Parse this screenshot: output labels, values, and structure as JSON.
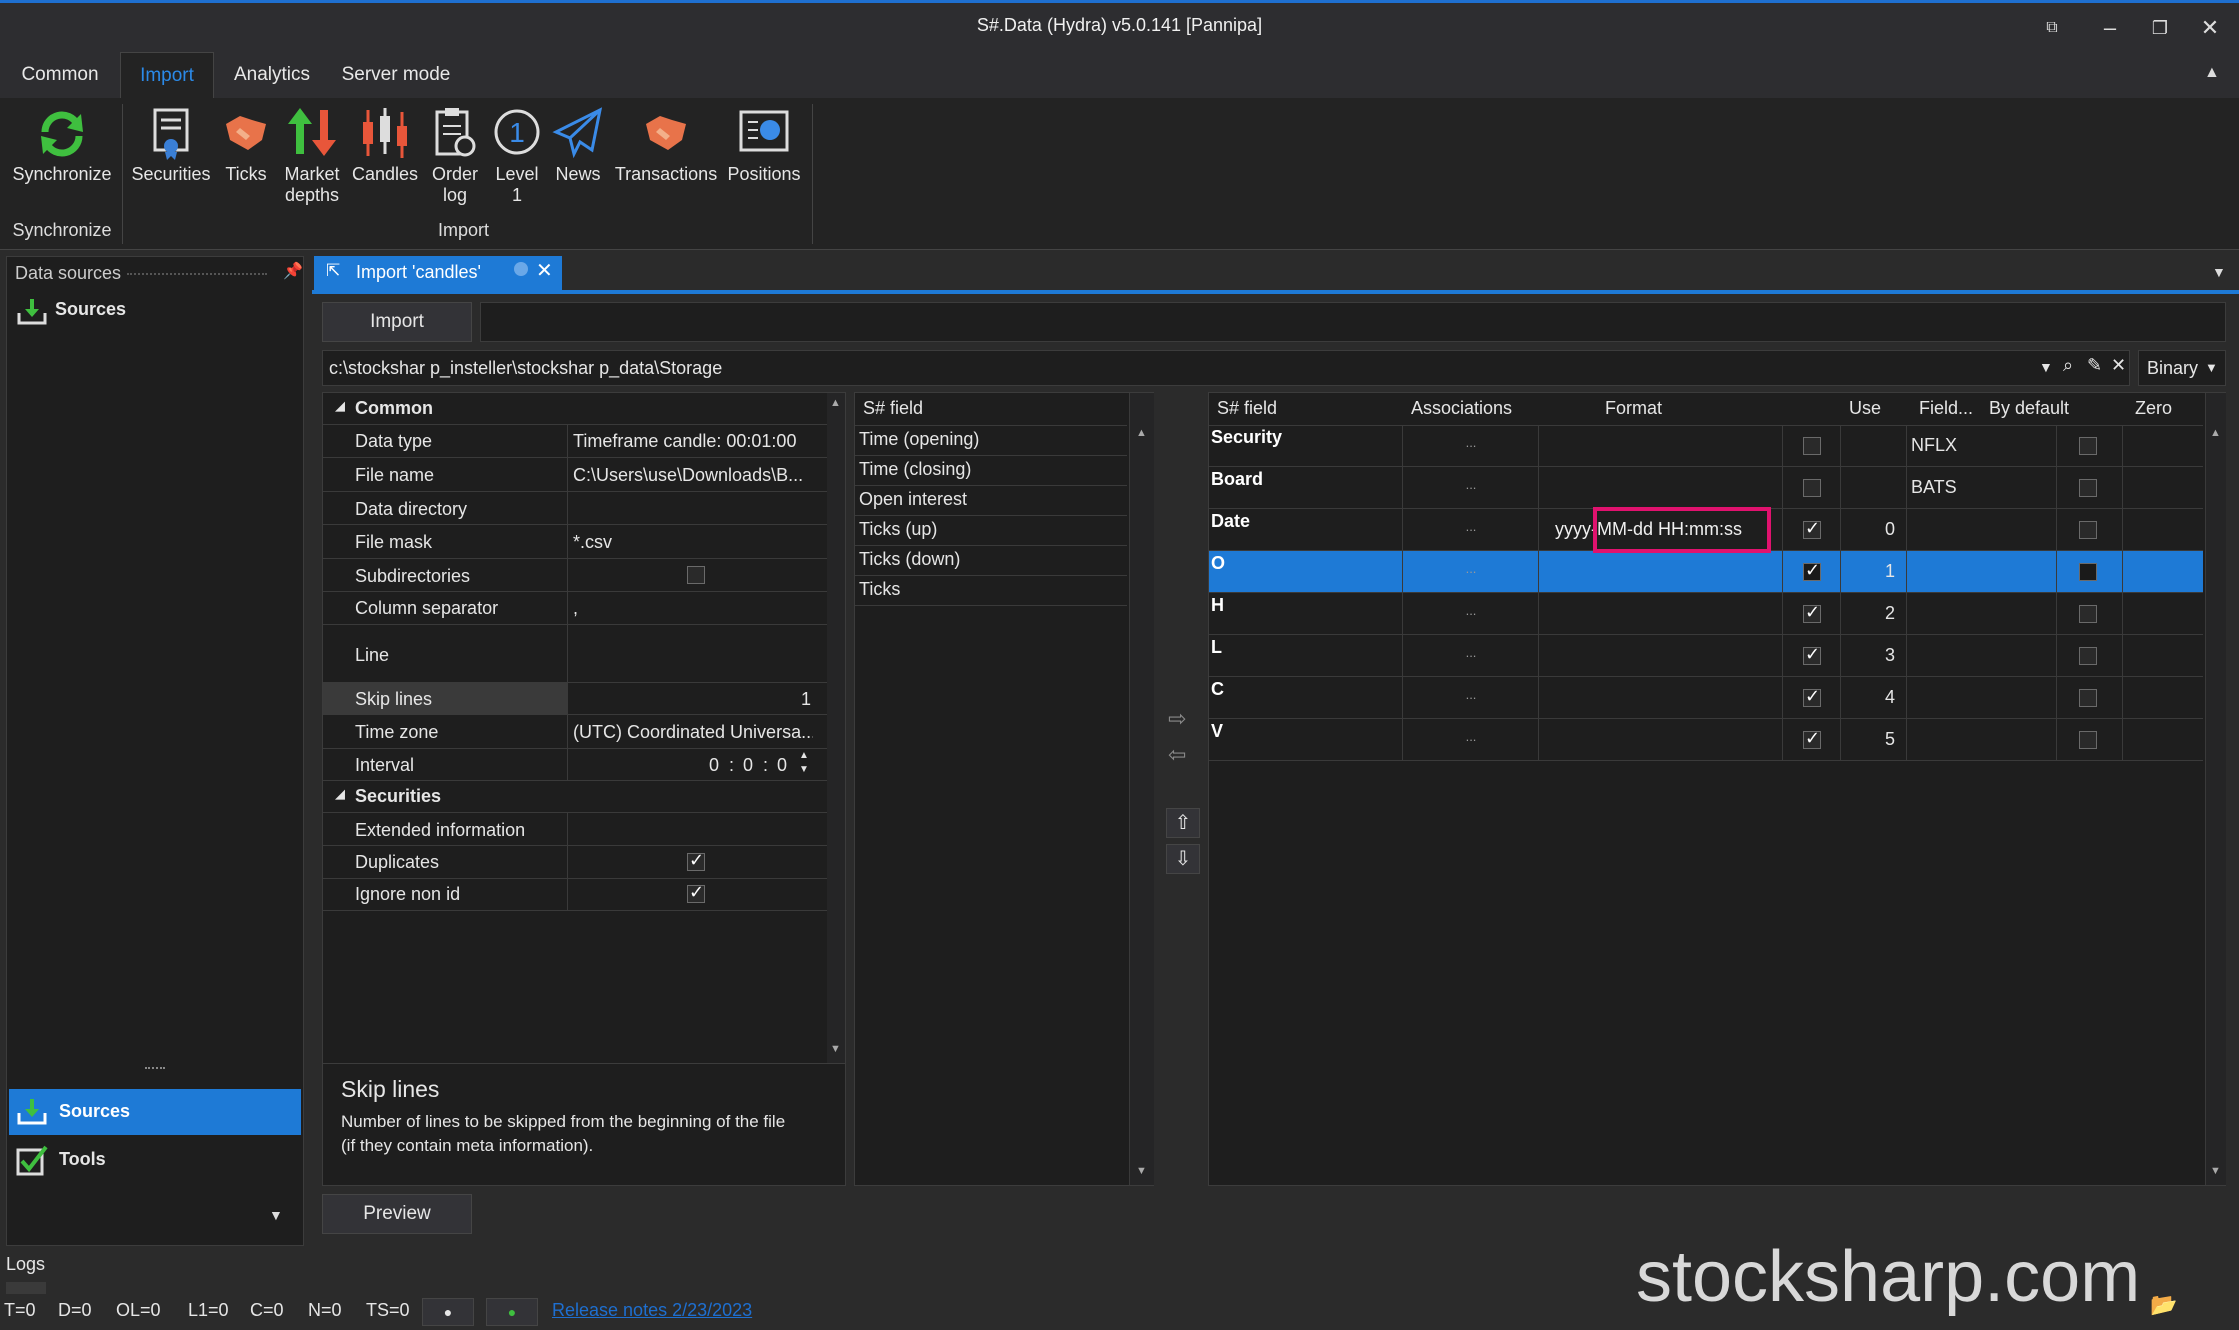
{
  "window": {
    "title": "S#.Data (Hydra) v5.0.141 [Pannipa]"
  },
  "ribbon": {
    "tabs": [
      "Common",
      "Import",
      "Analytics",
      "Server mode"
    ],
    "buttons": {
      "synchronize": "Synchronize",
      "securities": "Securities",
      "ticks": "Ticks",
      "market_depths_1": "Market",
      "market_depths_2": "depths",
      "candles": "Candles",
      "order_log_1": "Order",
      "order_log_2": "log",
      "level1_1": "Level",
      "level1_2": "1",
      "news": "News",
      "transactions": "Transactions",
      "positions": "Positions"
    },
    "groups": {
      "synchronize": "Synchronize",
      "import": "Import"
    }
  },
  "left_panel": {
    "title": "Data sources",
    "tree_item": "Sources",
    "nav": [
      "Sources",
      "Tools"
    ]
  },
  "document": {
    "tab_title": "Import 'candles'",
    "import_button": "Import",
    "path": "c:\\stockshar p_insteller\\stockshar p_data\\Storage",
    "format": "Binary",
    "preview_button": "Preview"
  },
  "properties": {
    "common_header": "Common",
    "rows": [
      {
        "name": "Data type",
        "value": "Timeframe candle: 00:01:00"
      },
      {
        "name": "File name",
        "value": "C:\\Users\\use\\Downloads\\B..."
      },
      {
        "name": "Data directory",
        "value": ""
      },
      {
        "name": "File mask",
        "value": "*.csv"
      },
      {
        "name": "Subdirectories",
        "value": ""
      },
      {
        "name": "Column separator",
        "value": ","
      },
      {
        "name": "Line",
        "value": ""
      },
      {
        "name": "Skip lines",
        "value": "1"
      },
      {
        "name": "Time zone",
        "value": "(UTC) Coordinated Universa..."
      },
      {
        "name": "Interval",
        "value": ""
      }
    ],
    "interval_parts": [
      "0",
      ":",
      "0",
      ":",
      "0"
    ],
    "securities_header": "Securities",
    "sec_rows": [
      {
        "name": "Extended information",
        "value": ""
      },
      {
        "name": "Duplicates",
        "value": ""
      },
      {
        "name": "Ignore non id",
        "value": ""
      }
    ],
    "description_title": "Skip lines",
    "description_text_1": "Number of lines to be skipped from the beginning of the file",
    "description_text_2": "(if they contain meta information)."
  },
  "available_fields": {
    "header": "S# field",
    "items": [
      "Time (opening)",
      "Time (closing)",
      "Open interest",
      "Ticks (up)",
      "Ticks (down)",
      "Ticks"
    ]
  },
  "mapping_grid": {
    "columns": [
      "S# field",
      "Associations",
      "Format",
      "Use",
      "Field...",
      "By default",
      "Zero"
    ],
    "rows": [
      {
        "field": "Security",
        "assoc": "...",
        "format": "",
        "use": false,
        "index": "",
        "default": "NFLX",
        "zero": false
      },
      {
        "field": "Board",
        "assoc": "...",
        "format": "",
        "use": false,
        "index": "",
        "default": "BATS",
        "zero": false
      },
      {
        "field": "Date",
        "assoc": "...",
        "format": "yyyy-MM-dd HH:mm:ss",
        "use": true,
        "index": "0",
        "default": "",
        "zero": false
      },
      {
        "field": "O",
        "assoc": "...",
        "format": "",
        "use": true,
        "index": "1",
        "default": "",
        "zero": false
      },
      {
        "field": "H",
        "assoc": "...",
        "format": "",
        "use": true,
        "index": "2",
        "default": "",
        "zero": false
      },
      {
        "field": "L",
        "assoc": "...",
        "format": "",
        "use": true,
        "index": "3",
        "default": "",
        "zero": false
      },
      {
        "field": "C",
        "assoc": "...",
        "format": "",
        "use": true,
        "index": "4",
        "default": "",
        "zero": false
      },
      {
        "field": "V",
        "assoc": "...",
        "format": "",
        "use": true,
        "index": "5",
        "default": "",
        "zero": false
      }
    ],
    "selected_row": 3,
    "highlight_color": "#e0126e",
    "selection_color": "#1e7ad6"
  },
  "logs": {
    "title": "Logs"
  },
  "status_bar": {
    "counters": [
      "T=0",
      "D=0",
      "OL=0",
      "L1=0",
      "C=0",
      "N=0",
      "TS=0"
    ],
    "release_notes": "Release notes 2/23/2023"
  },
  "watermark": "stocksharp.com"
}
